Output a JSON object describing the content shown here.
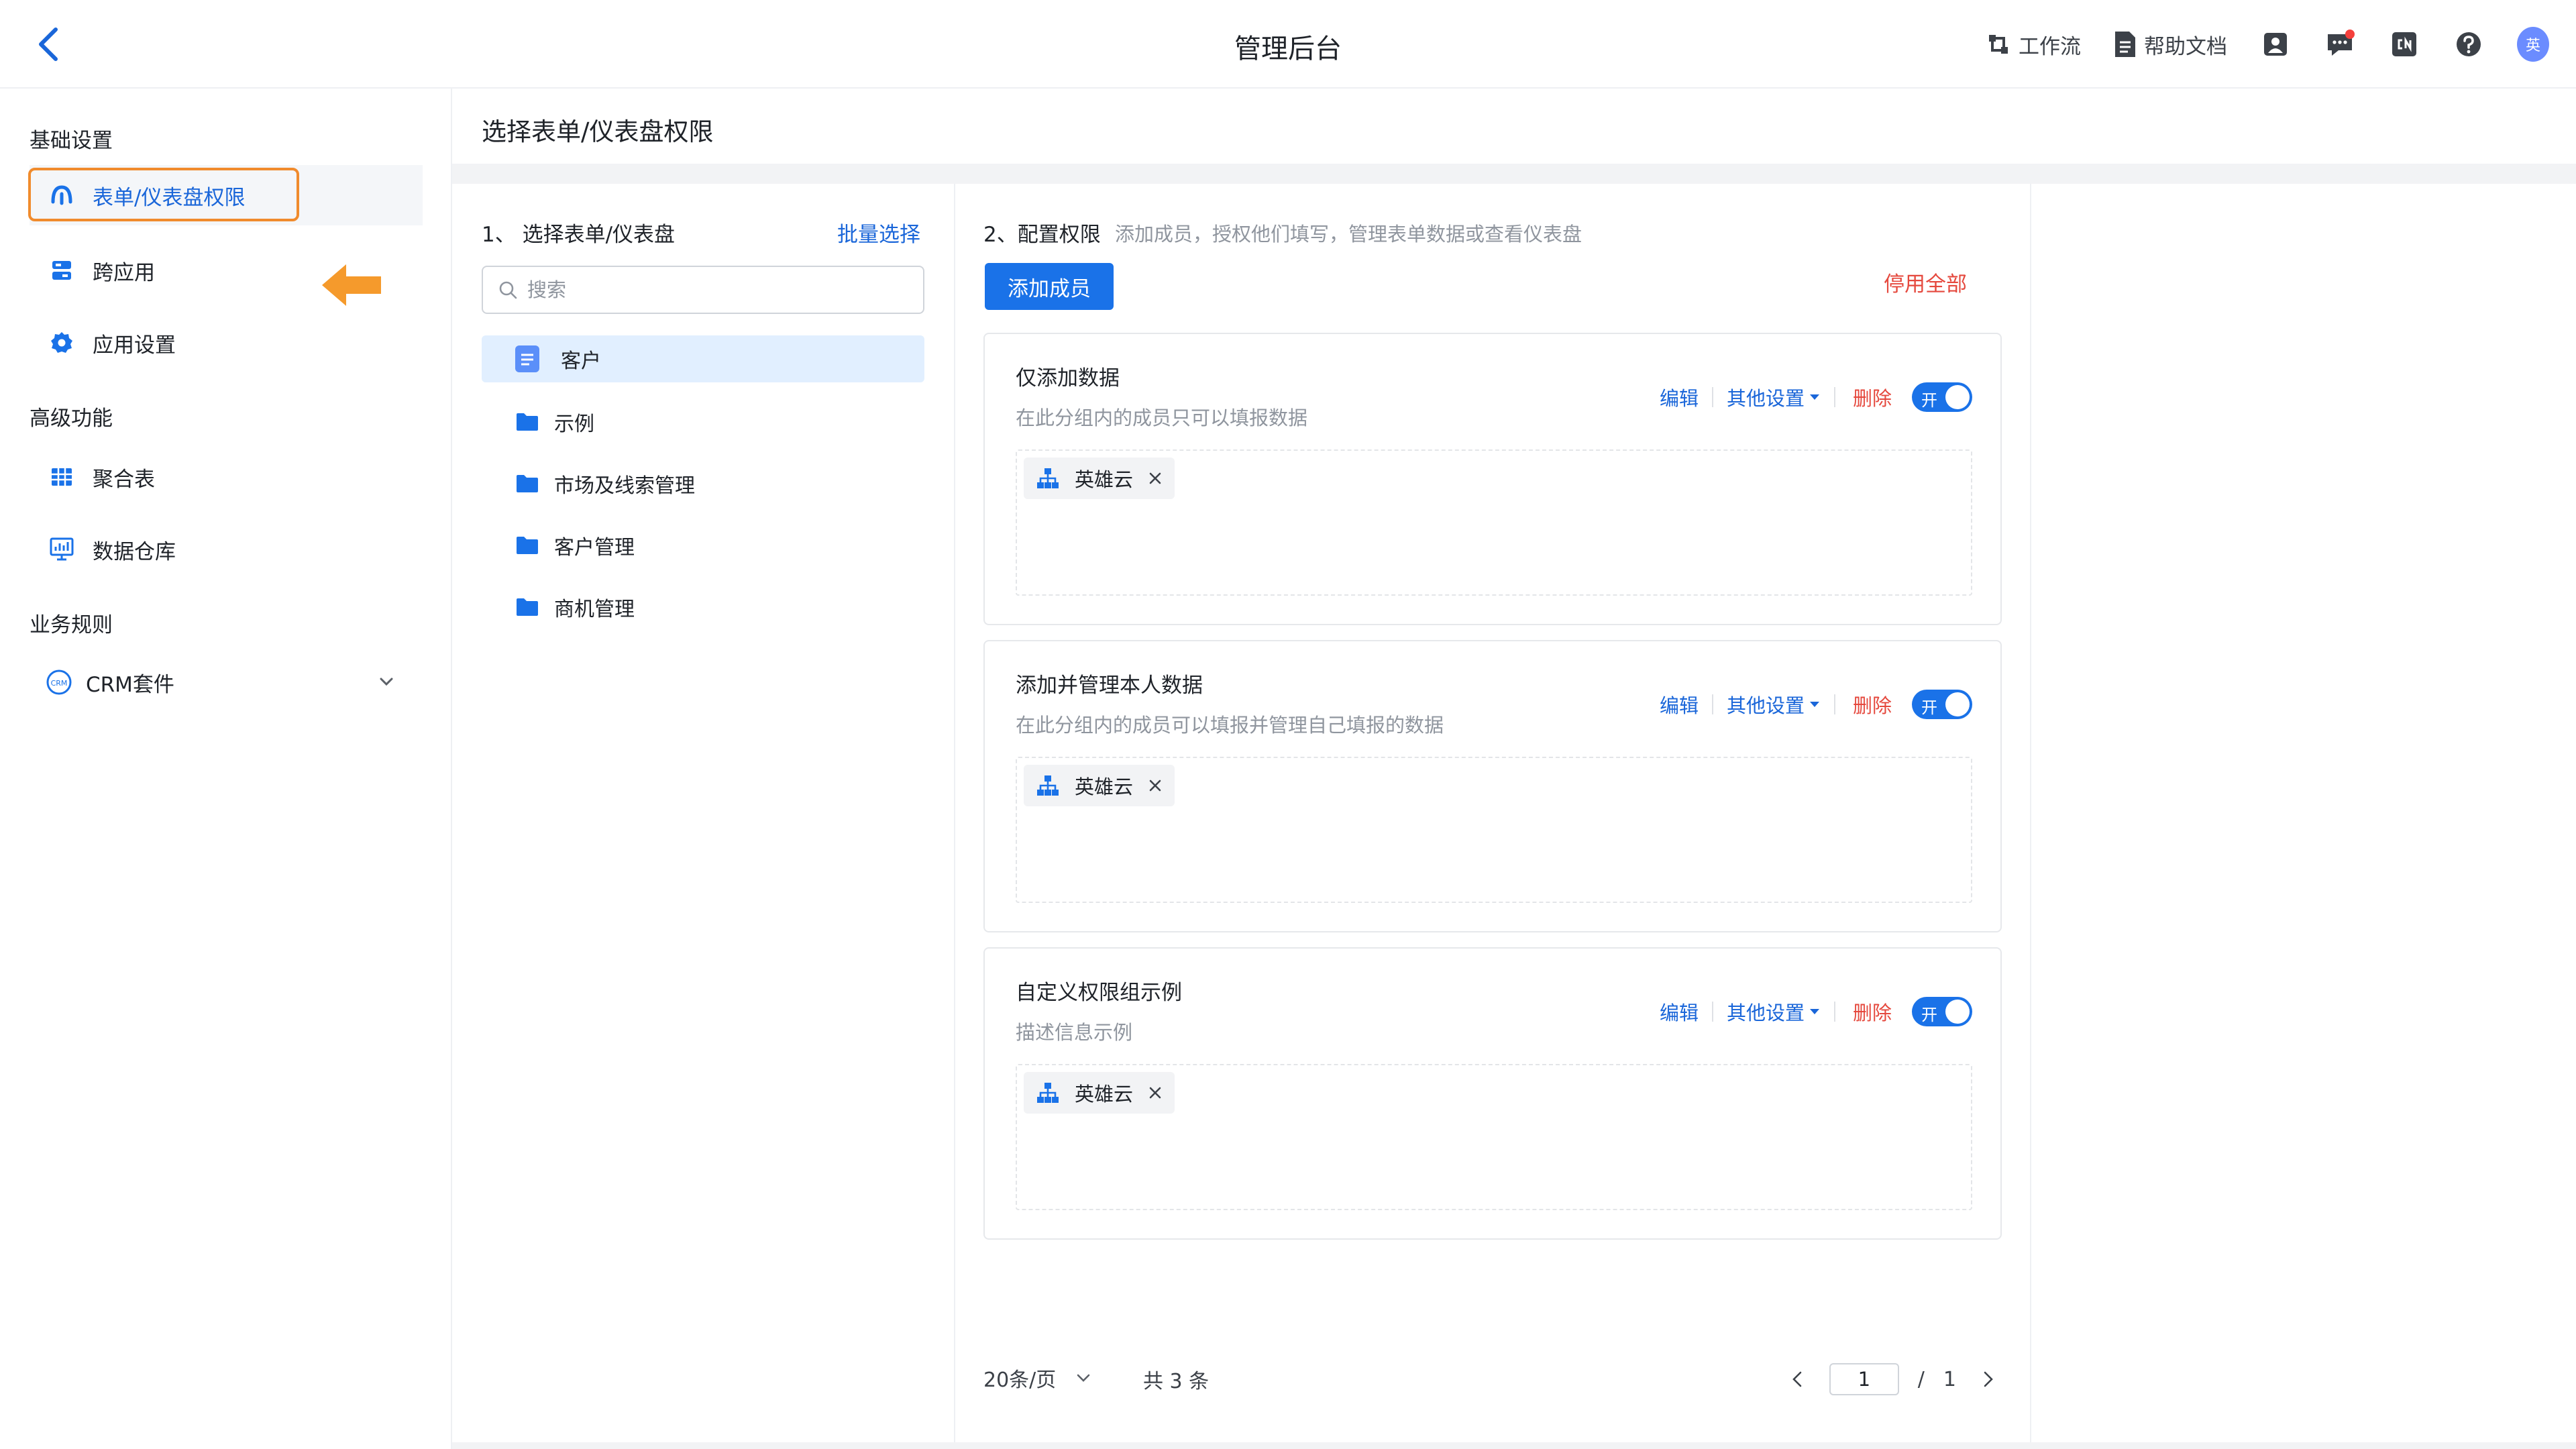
{
  "header": {
    "title": "管理后台",
    "links": [
      {
        "label": "工作流",
        "icon": "workflow-icon"
      },
      {
        "label": "帮助文档",
        "icon": "document-icon"
      }
    ],
    "avatar_text": "英"
  },
  "sidebar": {
    "sections": [
      {
        "title": "基础设置"
      },
      {
        "title": "高级功能"
      },
      {
        "title": "业务规则"
      }
    ],
    "items": [
      {
        "label": "表单/仪表盘权限",
        "icon": "cloud-permission-icon"
      },
      {
        "label": "跨应用",
        "icon": "cross-app-icon"
      },
      {
        "label": "应用设置",
        "icon": "gear-icon"
      },
      {
        "label": "聚合表",
        "icon": "table-icon"
      },
      {
        "label": "数据仓库",
        "icon": "data-warehouse-icon"
      },
      {
        "label": "CRM套件",
        "icon": "crm-icon"
      }
    ]
  },
  "main": {
    "title": "选择表单/仪表盘权限"
  },
  "forms_panel": {
    "title": "1、 选择表单/仪表盘",
    "batch_select": "批量选择",
    "search_placeholder": "搜索",
    "items": [
      {
        "label": "客户",
        "icon": "form-icon"
      },
      {
        "label": "示例",
        "icon": "folder-icon"
      },
      {
        "label": "市场及线索管理",
        "icon": "folder-icon"
      },
      {
        "label": "客户管理",
        "icon": "folder-icon"
      },
      {
        "label": "商机管理",
        "icon": "folder-icon"
      }
    ]
  },
  "config_panel": {
    "title": "2、配置权限",
    "subtitle": "添加成员，授权他们填写，管理表单数据或查看仪表盘",
    "add_member": "添加成员",
    "disable_all": "停用全部",
    "action_edit": "编辑",
    "action_other": "其他设置",
    "action_delete": "删除",
    "toggle_label": "开",
    "groups": [
      {
        "name": "仅添加数据",
        "desc": "在此分组内的成员只可以填报数据",
        "enabled": true,
        "members": [
          "英雄云"
        ]
      },
      {
        "name": "添加并管理本人数据",
        "desc": "在此分组内的成员可以填报并管理自己填报的数据",
        "enabled": true,
        "members": [
          "英雄云"
        ]
      },
      {
        "name": "自定义权限组示例",
        "desc": "描述信息示例",
        "enabled": true,
        "members": [
          "英雄云"
        ]
      }
    ]
  },
  "pagination": {
    "page_size": "20条/页",
    "total": "共 3 条",
    "current_page": "1",
    "separator": "/",
    "total_pages": "1"
  },
  "colors": {
    "primary": "#1a72e8",
    "link": "#1a66d9",
    "danger": "#e5483d",
    "highlight": "#f08b2d",
    "selected_bg": "#e1efff"
  }
}
